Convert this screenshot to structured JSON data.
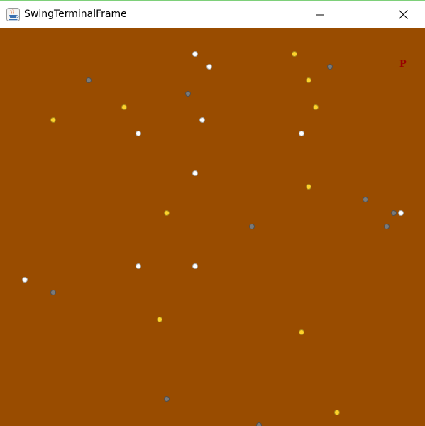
{
  "window": {
    "title": "SwingTerminalFrame",
    "app_icon": "java-cup-icon",
    "controls": [
      "minimize-icon",
      "maximize-icon",
      "close-icon"
    ]
  },
  "game": {
    "background_color": "#994c00",
    "player": {
      "glyph": "P",
      "color": "#990000"
    },
    "item_colors": {
      "gold": "#ffd22a",
      "white": "#ffffff",
      "gray": "#7a7a7a"
    },
    "items": [
      {
        "type": "white",
        "col": 27,
        "row": 1
      },
      {
        "type": "gold",
        "col": 41,
        "row": 1
      },
      {
        "type": "white",
        "col": 29,
        "row": 2
      },
      {
        "type": "gray",
        "col": 46,
        "row": 2
      },
      {
        "type": "gray",
        "col": 12,
        "row": 3
      },
      {
        "type": "gold",
        "col": 43,
        "row": 3
      },
      {
        "type": "gray",
        "col": 26,
        "row": 4
      },
      {
        "type": "gold",
        "col": 17,
        "row": 5
      },
      {
        "type": "gold",
        "col": 44,
        "row": 5
      },
      {
        "type": "gold",
        "col": 7,
        "row": 6
      },
      {
        "type": "white",
        "col": 28,
        "row": 6
      },
      {
        "type": "white",
        "col": 19,
        "row": 7
      },
      {
        "type": "white",
        "col": 42,
        "row": 7
      },
      {
        "type": "white",
        "col": 27,
        "row": 10
      },
      {
        "type": "gold",
        "col": 43,
        "row": 11
      },
      {
        "type": "gray",
        "col": 51,
        "row": 12
      },
      {
        "type": "gold",
        "col": 23,
        "row": 13
      },
      {
        "type": "gray",
        "col": 55,
        "row": 13
      },
      {
        "type": "white",
        "col": 56,
        "row": 13
      },
      {
        "type": "gray",
        "col": 35,
        "row": 14
      },
      {
        "type": "gray",
        "col": 54,
        "row": 14
      },
      {
        "type": "white",
        "col": 19,
        "row": 17
      },
      {
        "type": "white",
        "col": 27,
        "row": 17
      },
      {
        "type": "white",
        "col": 3,
        "row": 18
      },
      {
        "type": "gray",
        "col": 7,
        "row": 19
      },
      {
        "type": "gold",
        "col": 22,
        "row": 21
      },
      {
        "type": "gold",
        "col": 42,
        "row": 22
      },
      {
        "type": "gray",
        "col": 23,
        "row": 27
      },
      {
        "type": "gold",
        "col": 47,
        "row": 28
      },
      {
        "type": "gray",
        "col": 36,
        "row": 29
      }
    ],
    "player_pos": {
      "col": 56,
      "row": 2
    }
  }
}
